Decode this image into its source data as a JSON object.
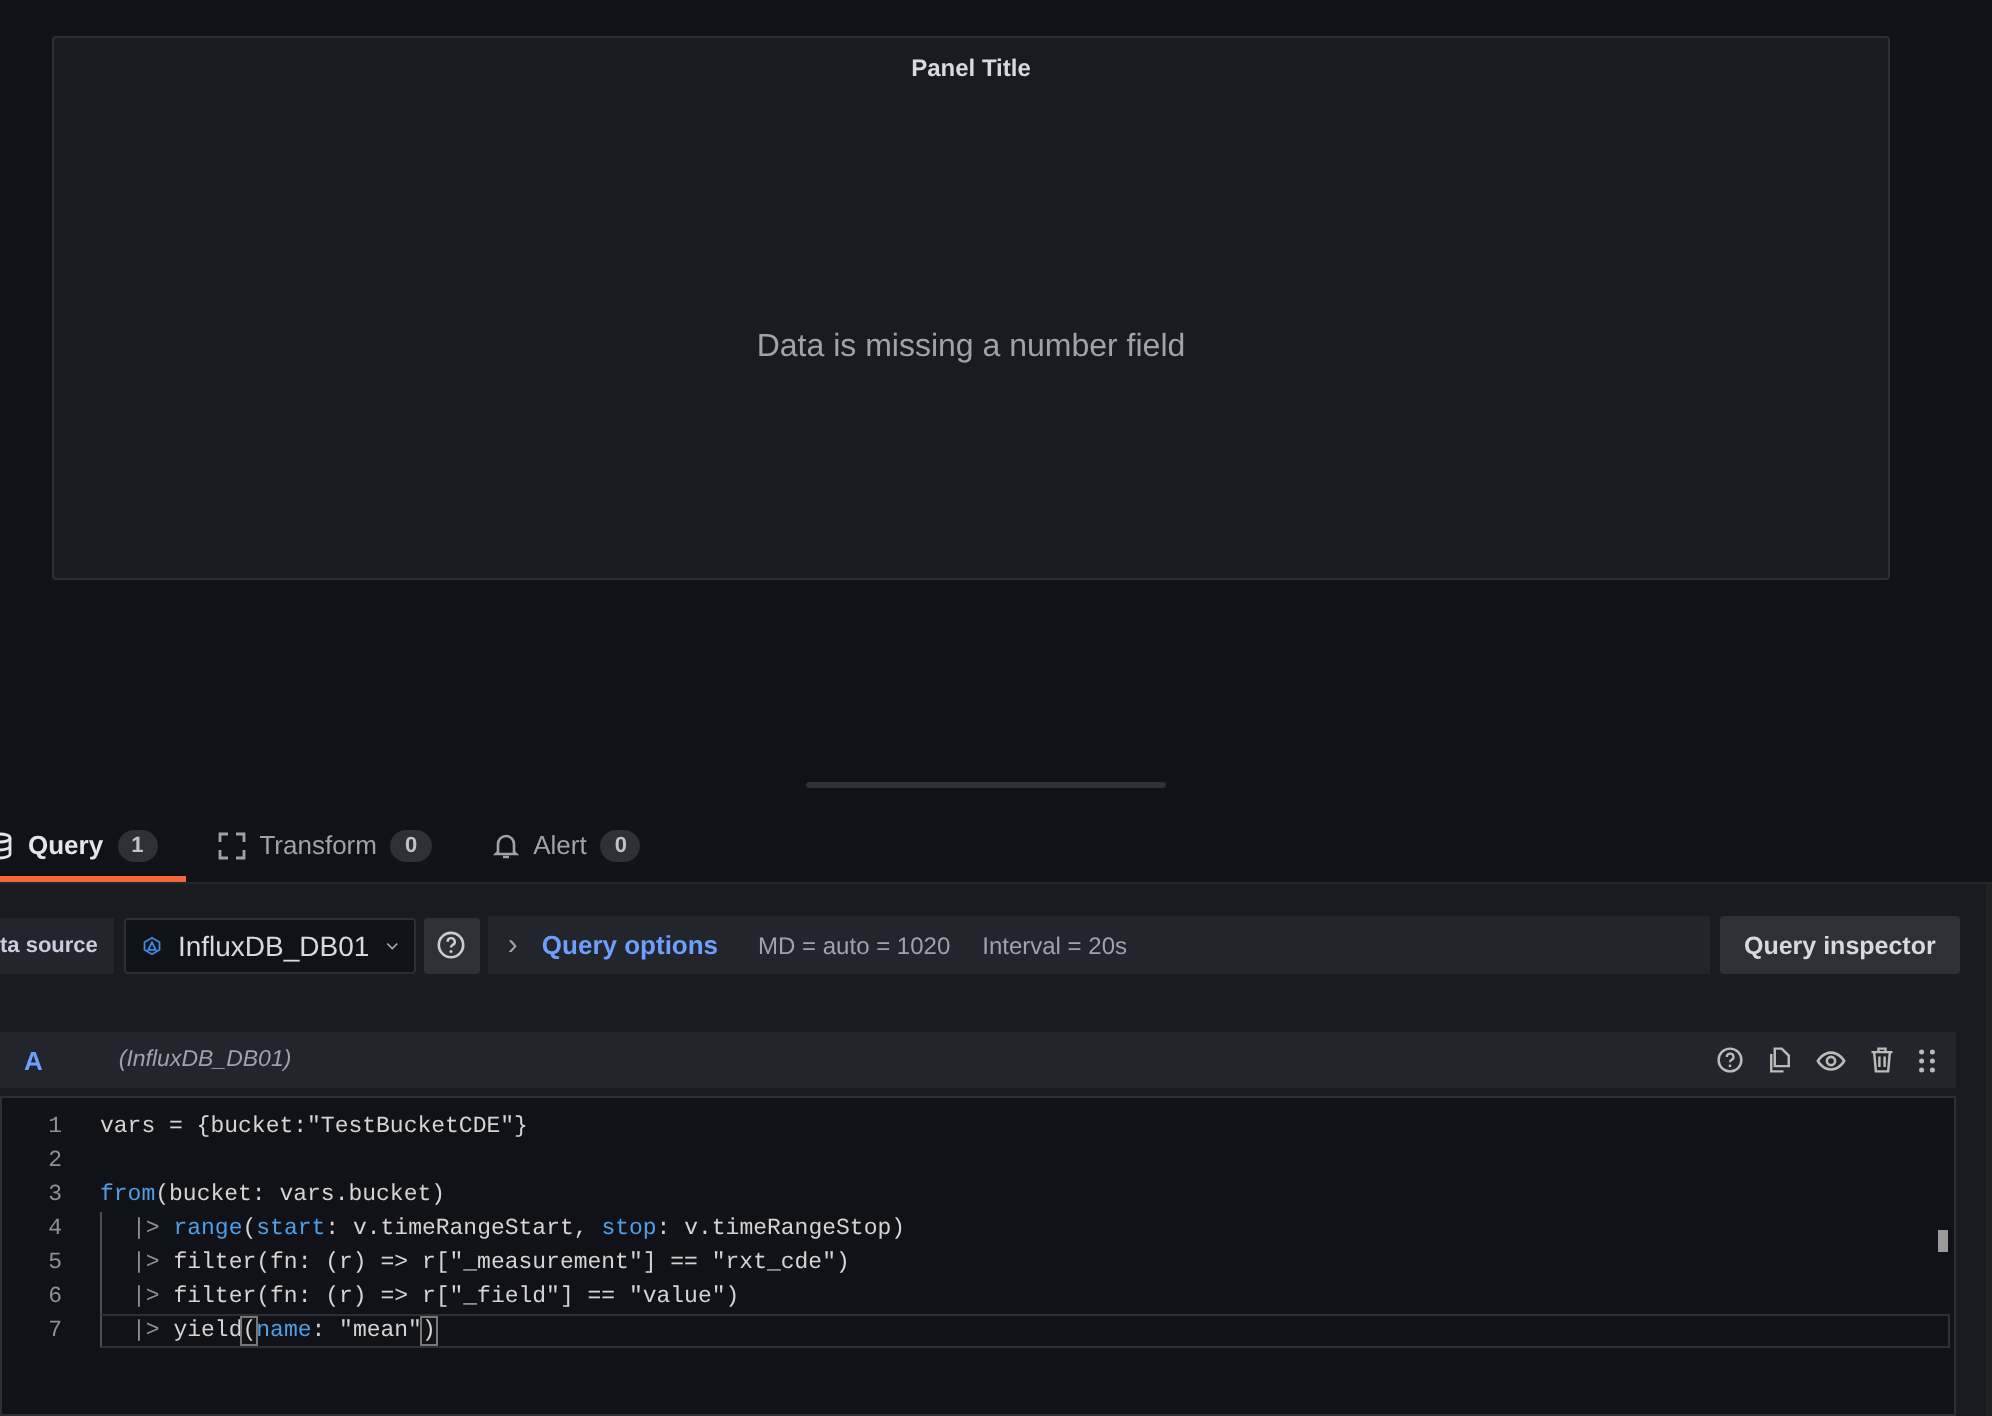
{
  "panel": {
    "title": "Panel Title",
    "message": "Data is missing a number field"
  },
  "tabs": [
    {
      "label": "Query",
      "count": "1",
      "kind": "database",
      "selected": true
    },
    {
      "label": "Transform",
      "count": "0",
      "kind": "transform",
      "selected": false
    },
    {
      "label": "Alert",
      "count": "0",
      "kind": "bell",
      "selected": false
    }
  ],
  "toolbar": {
    "datasource_label": "ta source",
    "datasource": "InfluxDB_DB01",
    "query_options": {
      "chevron": "›",
      "label": "Query options",
      "md": "MD = auto = 1020",
      "interval": "Interval = 20s"
    },
    "inspector_button": "Query inspector"
  },
  "query": {
    "ref": "A",
    "datasource": "(InfluxDB_DB01)",
    "lines": [
      {
        "number": "1",
        "indent": false,
        "current": false,
        "tokens": [
          {
            "text": "vars = {bucket:\"TestBucketCDE\"}",
            "kind": "plain"
          }
        ]
      },
      {
        "number": "2",
        "indent": false,
        "current": false
      },
      {
        "number": "3",
        "indent": false,
        "current": false,
        "tokens": [
          {
            "text": "from",
            "kind": "fn"
          },
          {
            "text": "(bucket: vars.bucket)",
            "kind": "plain"
          }
        ]
      },
      {
        "number": "4",
        "indent": true,
        "current": false,
        "tokens": [
          {
            "text": "|> ",
            "kind": "pipe"
          },
          {
            "text": "range",
            "kind": "fn"
          },
          {
            "text": "(",
            "kind": "plain"
          },
          {
            "text": "start",
            "kind": "fn"
          },
          {
            "text": ": v.timeRangeStart, ",
            "kind": "plain"
          },
          {
            "text": "stop",
            "kind": "fn"
          },
          {
            "text": ": v.timeRangeStop)",
            "kind": "plain"
          }
        ]
      },
      {
        "number": "5",
        "indent": true,
        "current": false,
        "tokens": [
          {
            "text": "|> ",
            "kind": "pipe"
          },
          {
            "text": "filter(fn: (r) => r[\"_measurement\"] == \"rxt_cde\")",
            "kind": "plain"
          }
        ]
      },
      {
        "number": "6",
        "indent": true,
        "current": false,
        "tokens": [
          {
            "text": "|> ",
            "kind": "pipe"
          },
          {
            "text": "filter(fn: (r) => r[\"_field\"] == \"value\")",
            "kind": "plain"
          }
        ]
      },
      {
        "number": "7",
        "indent": true,
        "current": true,
        "tokens": [
          {
            "text": "|> ",
            "kind": "pipe"
          },
          {
            "text": "yield",
            "kind": "plain"
          },
          {
            "text": "(",
            "kind": "bracket"
          },
          {
            "text": "name",
            "kind": "fn"
          },
          {
            "text": ": \"mean\"",
            "kind": "plain"
          },
          {
            "text": ")",
            "kind": "bracket"
          }
        ]
      }
    ]
  }
}
